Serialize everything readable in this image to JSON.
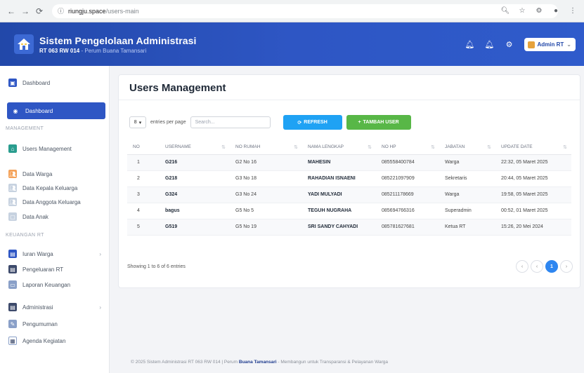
{
  "browser": {
    "url_host": "riungju.space",
    "url_path": "/users-main"
  },
  "header": {
    "title": "Sistem Pengelolaan Administrasi",
    "sub_bold": "RT 063 RW 014",
    "sub_rest": " - Perum Buana Tamansari",
    "user_label": "Admin RT"
  },
  "sidebar": {
    "top_item": "Dashboard",
    "active_item": "Dashboard",
    "section_management": "MANAGEMENT",
    "management_items": [
      "Users Management",
      "Data Warga",
      "Data Kepala Keluarga",
      "Data Anggota Keluarga",
      "Data Anak"
    ],
    "section_keuangan": "KEUANGAN RT",
    "keuangan_items": [
      "Iuran Warga",
      "Pengeluaran RT",
      "Laporan Keuangan"
    ],
    "other_items": [
      "Administrasi",
      "Pengumuman",
      "Agenda Kegiatan"
    ]
  },
  "main": {
    "title": "Users Management",
    "entries_value": "8",
    "entries_label": "entries per page",
    "search_placeholder": "Search...",
    "refresh_label": "REFRESH",
    "add_label": "TAMBAH USER",
    "showing_text": "Showing 1 to 6 of 6 entries",
    "page_current": "1"
  },
  "table": {
    "columns": [
      "NO",
      "USERNAME",
      "NO RUMAH",
      "NAMA LENGKAP",
      "NO HP",
      "JABATAN",
      "UPDATE DATE"
    ],
    "rows": [
      [
        "1",
        "G216",
        "G2 No 16",
        "MAHESIN",
        "085558400784",
        "Warga",
        "22:32, 05 Maret 2025"
      ],
      [
        "2",
        "G218",
        "G3 No 18",
        "RAHADIAN ISNAENI",
        "085221097909",
        "Sekretaris",
        "20:44, 05 Maret 2025"
      ],
      [
        "3",
        "G324",
        "G3 No 24",
        "YADI MULYADI",
        "085211178669",
        "Warga",
        "19:58, 05 Maret 2025"
      ],
      [
        "4",
        "bagus",
        "G5 No 5",
        "TEGUH NUGRAHA",
        "085694766316",
        "Superadmin",
        "00:52, 01 Maret 2025"
      ],
      [
        "5",
        "G519",
        "G5 No 19",
        "SRI SANDY CAHYADI",
        "085781627681",
        "Ketua RT",
        "15:26, 20 Mei 2024"
      ]
    ]
  },
  "footer": {
    "left": "© 2025 Sistem Administrasi RT 063 RW 014 | Perum ",
    "brand": "Buana Tamansari",
    "right": " - Membangun untuk Transparansi & Pelayanan Warga"
  },
  "colors": {
    "brand": "#2e56c4",
    "refresh": "#1fa2f4",
    "add": "#58b747",
    "pager_active": "#2e86f0"
  }
}
